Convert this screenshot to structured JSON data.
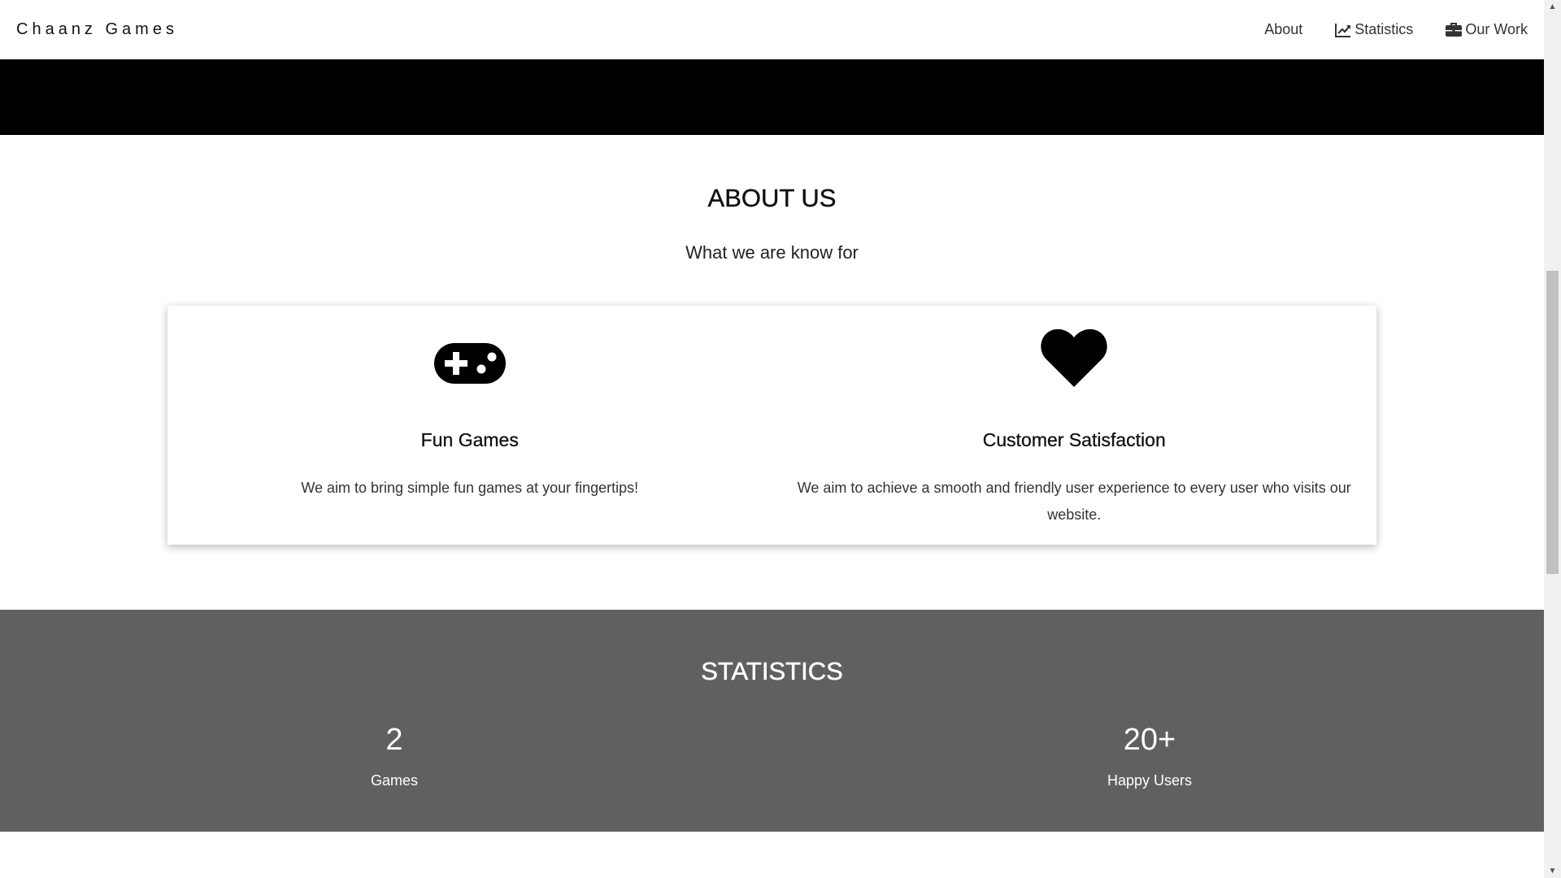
{
  "nav": {
    "brand": "Chaanz Games",
    "links": [
      {
        "label": "About",
        "icon": "none"
      },
      {
        "label": "Statistics",
        "icon": "line-chart-icon"
      },
      {
        "label": "Our Work",
        "icon": "briefcase-icon"
      }
    ]
  },
  "about": {
    "title": "ABOUT US",
    "subtitle": "What we are know for",
    "features": [
      {
        "icon": "gamepad-icon",
        "title": "Fun Games",
        "text": "We aim to bring simple fun games at your fingertips!"
      },
      {
        "icon": "heart-icon",
        "title": "Customer Satisfaction",
        "text": "We aim to achieve a smooth and friendly user experience to every user who visits our website."
      }
    ]
  },
  "statistics": {
    "title": "STATISTICS",
    "items": [
      {
        "number": "2",
        "label": "Games"
      },
      {
        "number": "20+",
        "label": "Happy Users"
      }
    ]
  },
  "colors": {
    "hero_band": "#000000",
    "stats_background": "#606060",
    "card_background": "#ffffff"
  }
}
